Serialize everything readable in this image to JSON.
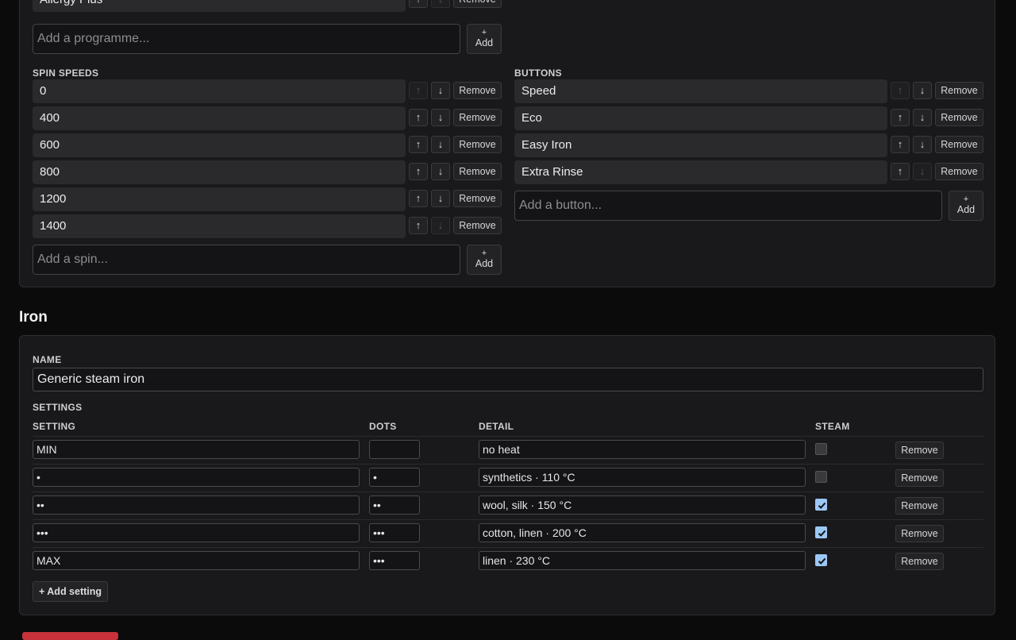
{
  "washer": {
    "programmes": {
      "last_item": "Allergy Plus",
      "add_placeholder": "Add a programme..."
    },
    "spin_speeds": {
      "label": "SPIN SPEEDS",
      "items": [
        "0",
        "400",
        "600",
        "800",
        "1200",
        "1400"
      ],
      "add_placeholder": "Add a spin..."
    },
    "buttons": {
      "label": "BUTTONS",
      "items": [
        "Speed",
        "Eco",
        "Easy Iron",
        "Extra Rinse"
      ],
      "add_placeholder": "Add a button..."
    }
  },
  "common": {
    "remove_label": "Remove",
    "add_plus": "+",
    "add_label": "Add",
    "up_icon": "↑",
    "down_icon": "↓"
  },
  "iron": {
    "section_title": "Iron",
    "name_label": "NAME",
    "name_value": "Generic steam iron",
    "settings_label": "SETTINGS",
    "columns": [
      "SETTING",
      "DOTS",
      "DETAIL",
      "STEAM"
    ],
    "rows": [
      {
        "setting": "MIN",
        "dots": "",
        "detail": "no heat",
        "steam": false
      },
      {
        "setting": "•",
        "dots": "•",
        "detail": "synthetics · 110 °C",
        "steam": false
      },
      {
        "setting": "••",
        "dots": "••",
        "detail": "wool, silk · 150 °C",
        "steam": true
      },
      {
        "setting": "•••",
        "dots": "•••",
        "detail": "cotton, linen · 200 °C",
        "steam": true
      },
      {
        "setting": "MAX",
        "dots": "•••",
        "detail": "linen · 230 °C",
        "steam": true
      }
    ],
    "add_setting_label": "+ Add setting"
  },
  "colors": {
    "background": "#0b0b0c",
    "card": "#19191b",
    "checkbox_checked": "#9cc8f5",
    "danger": "#c8323a"
  }
}
